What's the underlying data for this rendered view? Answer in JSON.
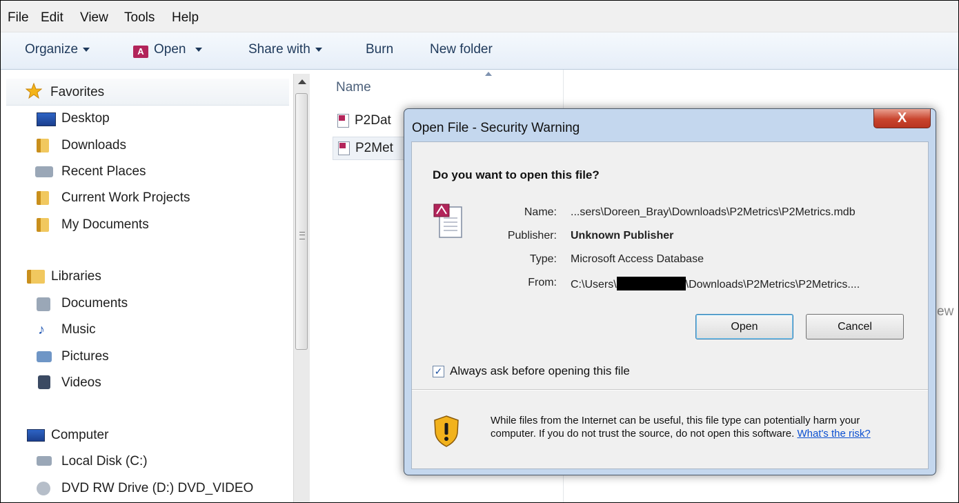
{
  "menu": [
    "File",
    "Edit",
    "View",
    "Tools",
    "Help"
  ],
  "toolbar": {
    "organize": "Organize",
    "open": "Open",
    "share": "Share with",
    "burn": "Burn",
    "new_folder": "New folder"
  },
  "nav": {
    "favorites": {
      "label": "Favorites",
      "items": [
        "Desktop",
        "Downloads",
        "Recent Places",
        "Current Work Projects",
        "My Documents"
      ]
    },
    "libraries": {
      "label": "Libraries",
      "items": [
        "Documents",
        "Music",
        "Pictures",
        "Videos"
      ]
    },
    "computer": {
      "label": "Computer",
      "items": [
        "Local Disk (C:)",
        "DVD RW Drive (D:) DVD_VIDEO"
      ]
    }
  },
  "filelist": {
    "column_name": "Name",
    "files": [
      "P2Dat",
      "P2Met"
    ],
    "partial_text": "ew"
  },
  "dialog": {
    "title": "Open File - Security Warning",
    "close_label": "X",
    "question": "Do you want to open this file?",
    "name_label": "Name:",
    "name_value": "...sers\\Doreen_Bray\\Downloads\\P2Metrics\\P2Metrics.mdb",
    "publisher_label": "Publisher:",
    "publisher_value": "Unknown Publisher",
    "type_label": "Type:",
    "type_value": "Microsoft Access Database",
    "from_label": "From:",
    "from_prefix": "C:\\Users\\",
    "from_suffix": "\\Downloads\\P2Metrics\\P2Metrics....",
    "open_button": "Open",
    "cancel_button": "Cancel",
    "checkbox_label": "Always ask before opening this file",
    "checkbox_checked": true,
    "warning_text": "While files from the Internet can be useful, this file type can potentially harm your computer. If you do not trust the source, do not open this software.",
    "risk_link": "What's the risk?"
  },
  "colors": {
    "toolbar_text": "#1e395b",
    "dialog_frame": "#c4d7ee",
    "close_button": "#c9442d",
    "link": "#0b4fd1"
  }
}
